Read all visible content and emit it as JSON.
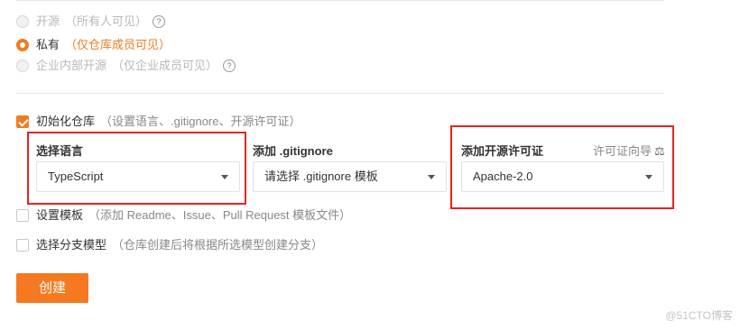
{
  "visibility": {
    "options": [
      {
        "label": "开源",
        "hint": "（所有人可见）",
        "checked": false,
        "help_icon": "question-circle-icon"
      },
      {
        "label": "私有",
        "hint": "（仅仓库成员可见）",
        "checked": true
      },
      {
        "label": "企业内部开源",
        "hint": "（仅企业成员可见）",
        "checked": false,
        "help_icon": "question-circle-icon"
      }
    ]
  },
  "init_repo": {
    "checked": true,
    "label": "初始化仓库",
    "hint": "（设置语言、.gitignore、开源许可证）",
    "language": {
      "title": "选择语言",
      "value": "TypeScript"
    },
    "gitignore": {
      "title": "添加 .gitignore",
      "value": "请选择 .gitignore 模板"
    },
    "license": {
      "title": "添加开源许可证",
      "value": "Apache-2.0",
      "guide_link": "许可证向导",
      "guide_icon": "scale-icon"
    }
  },
  "template": {
    "checked": false,
    "label": "设置模板",
    "hint": "（添加 Readme、Issue、Pull Request 模板文件）"
  },
  "branch_model": {
    "checked": false,
    "label": "选择分支模型",
    "hint": "（仓库创建后将根据所选模型创建分支）"
  },
  "create_button": "创建",
  "watermark": "@51CTO博客",
  "colors": {
    "accent": "#f47920",
    "highlight": "#e8241d"
  }
}
